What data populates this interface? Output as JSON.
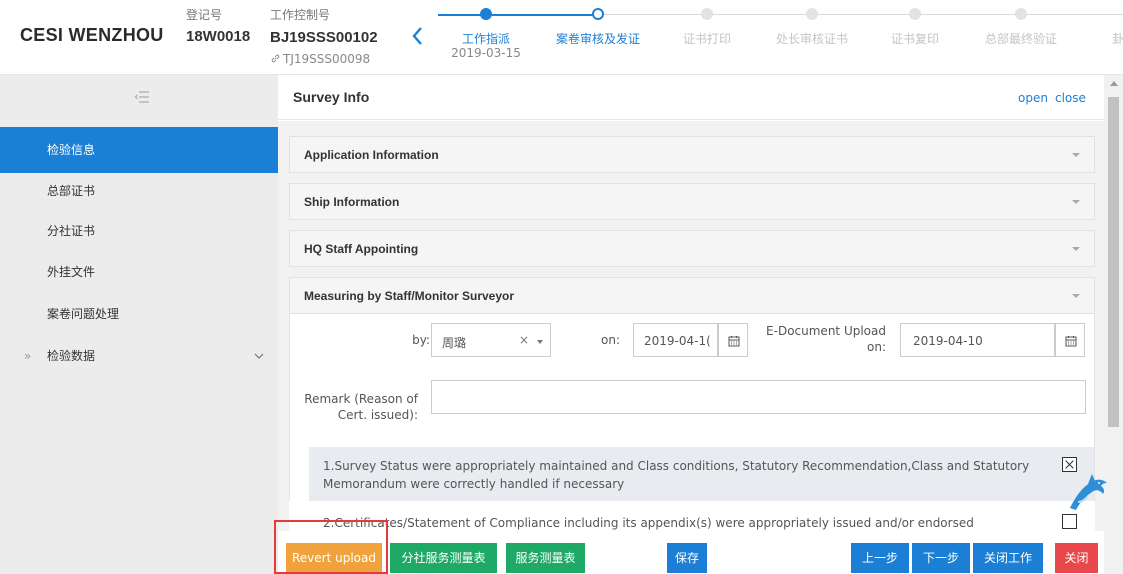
{
  "header": {
    "brand": "CESI WENZHOU",
    "reg_label": "登记号",
    "reg_value": "18W0018",
    "ctrl_label": "工作控制号",
    "ctrl_value": "BJ19SSS00102",
    "ctrl_sub": "TJ19SSS00098",
    "back_icon": "chevron-left-icon"
  },
  "steps": [
    {
      "label": "工作指派",
      "date": "2019-03-15",
      "state": "done"
    },
    {
      "label": "案卷审核及发证",
      "date": "",
      "state": "current"
    },
    {
      "label": "证书打印",
      "date": "",
      "state": "pending"
    },
    {
      "label": "处长审核证书",
      "date": "",
      "state": "pending"
    },
    {
      "label": "证书复印",
      "date": "",
      "state": "pending"
    },
    {
      "label": "总部最终验证",
      "date": "",
      "state": "pending"
    },
    {
      "label": "卦",
      "date": "",
      "state": "pending"
    }
  ],
  "sidebar": {
    "toggle_icon": "collapse-menu-icon",
    "items": [
      {
        "label": "检验信息",
        "active": true
      },
      {
        "label": "总部证书"
      },
      {
        "label": "分社证书"
      },
      {
        "label": "外挂文件"
      },
      {
        "label": "案卷问题处理"
      },
      {
        "label": "检验数据",
        "prefix": "»",
        "expandable": true
      }
    ]
  },
  "panel": {
    "title": "Survey Info",
    "open": "open",
    "close": "close"
  },
  "accordions": [
    {
      "title": "Application Information"
    },
    {
      "title": "Ship Information"
    },
    {
      "title": "HQ Staff Appointing"
    },
    {
      "title": "Measuring by Staff/Monitor Surveyor",
      "expanded": true
    }
  ],
  "form": {
    "by_label": "by:",
    "by_value": "周璐",
    "clear_symbol": "×",
    "on_label": "on:",
    "on_value": "2019-04-1(",
    "upload_label_1": "E-Document Upload",
    "upload_label_2": "on:",
    "upload_value": "2019-04-10",
    "remark_label_1": "Remark (Reason of",
    "remark_label_2": "Cert. issued):",
    "remark_value": ""
  },
  "checks": [
    {
      "text": "1.Survey Status were appropriately maintained and Class conditions, Statutory Recommendation,Class and Statutory Memorandum were correctly handled if necessary",
      "checked": true
    },
    {
      "text": "2.Certificates/Statement of Compliance including its appendix(s) were appropriately issued and/or endorsed",
      "checked": false
    }
  ],
  "footer": {
    "revert": "Revert upload",
    "branch_table": "分社服务测量表",
    "service_table": "服务测量表",
    "save": "保存",
    "prev": "上一步",
    "next": "下一步",
    "close_work": "关闭工作",
    "close": "关闭"
  },
  "colors": {
    "primary": "#1c7fd6",
    "green": "#1fa967",
    "orange": "#f0a33c",
    "red": "#e8474c",
    "highlight": "#e53a3a"
  }
}
